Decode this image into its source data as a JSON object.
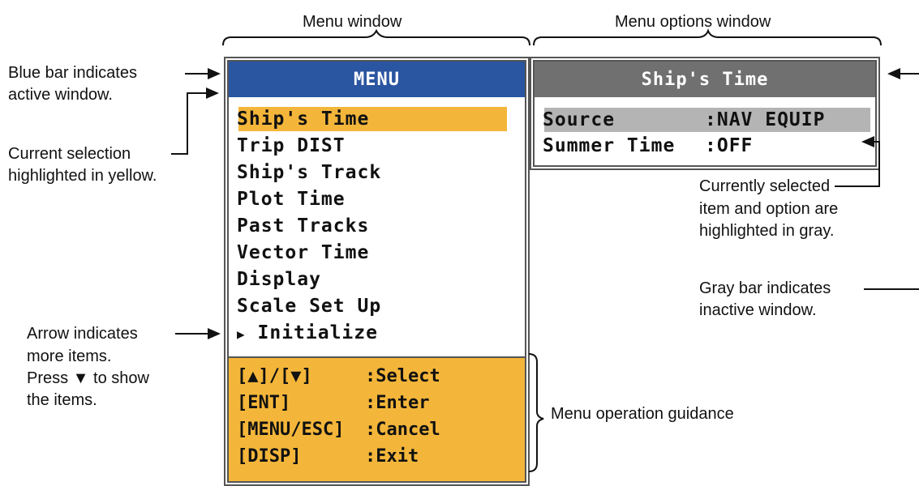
{
  "labels": {
    "menu_window": "Menu window",
    "options_window": "Menu options window",
    "blue_bar_1": "Blue bar indicates",
    "blue_bar_2": "active window.",
    "current_sel_1": "Current selection",
    "current_sel_2": "highlighted in yellow.",
    "arrow_1": "Arrow indicates",
    "arrow_2": "more items.",
    "arrow_3": "Press ▼ to show",
    "arrow_4": "the items.",
    "gray_sel_1": "Currently selected",
    "gray_sel_2": "item and option are",
    "gray_sel_3": "highlighted in gray.",
    "gray_bar_1": "Gray bar indicates",
    "gray_bar_2": "inactive window.",
    "guidance": "Menu operation guidance"
  },
  "menu": {
    "title": "MENU",
    "items": [
      "Ship's Time",
      "Trip DIST",
      "Ship's Track",
      "Plot Time",
      "Past Tracks",
      "Vector Time",
      "Display",
      "Scale Set Up",
      "Initialize"
    ],
    "more_arrow": "▶",
    "guide": [
      {
        "key": "[▲]/[▼]",
        "action": ":Select"
      },
      {
        "key": "[ENT]",
        "action": ":Enter"
      },
      {
        "key": "[MENU/ESC]",
        "action": ":Cancel"
      },
      {
        "key": "[DISP]",
        "action": ":Exit"
      }
    ]
  },
  "options": {
    "title": "Ship's Time",
    "rows": [
      {
        "item": "Source",
        "value": ":NAV EQUIP"
      },
      {
        "item": "Summer Time",
        "value": ":OFF"
      }
    ]
  },
  "colors": {
    "active_bar": "#2a55a0",
    "inactive_bar": "#707070",
    "selection_yellow": "#f4b63a",
    "selection_gray": "#b4b4b4"
  }
}
